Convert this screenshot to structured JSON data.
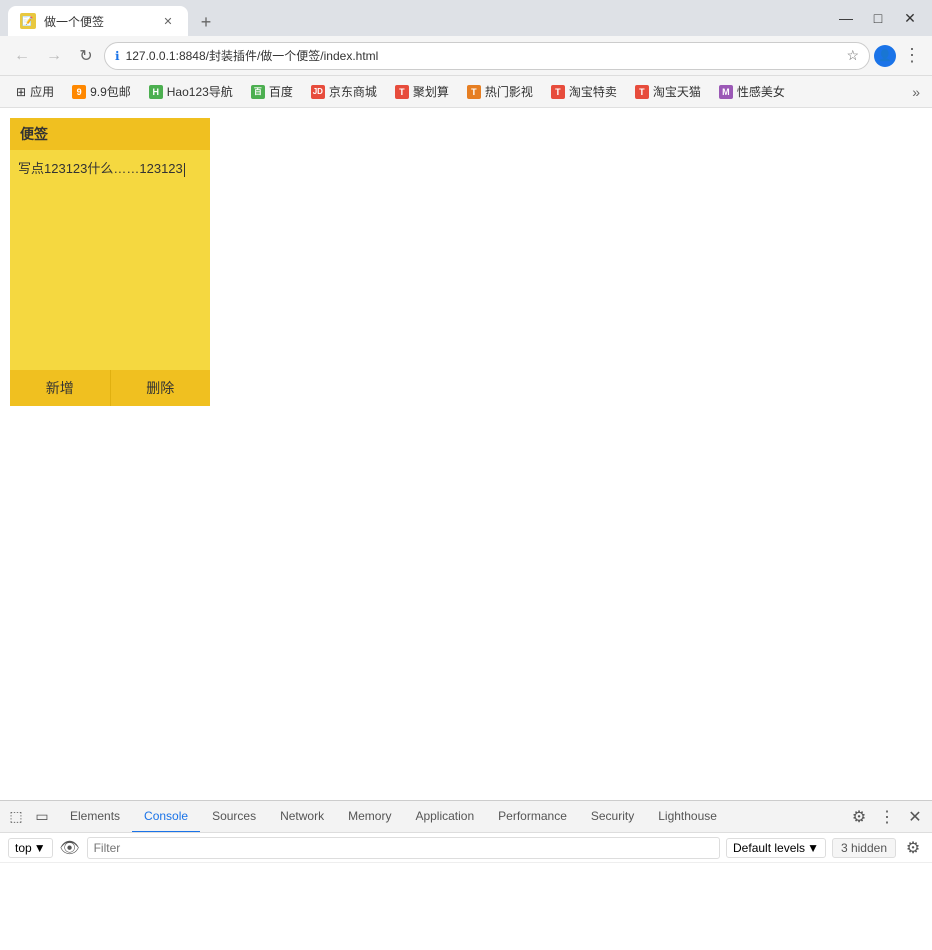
{
  "browser": {
    "tab_title": "做一个便签",
    "url": "127.0.0.1:8848/封装插件/做一个便签/index.html",
    "new_tab_label": "+",
    "window_controls": {
      "minimize": "—",
      "maximize": "□",
      "close": "✕"
    }
  },
  "bookmarks": [
    {
      "id": "apps",
      "label": "应用",
      "icon_color": "#555",
      "icon_char": "⊞"
    },
    {
      "id": "99baobao",
      "label": "9.9包邮",
      "icon_color": "#f80",
      "icon_char": "9"
    },
    {
      "id": "hao123",
      "label": "Hao123导航",
      "icon_color": "#4caf50",
      "icon_char": "H"
    },
    {
      "id": "baidu",
      "label": "百度",
      "icon_color": "#4caf50",
      "icon_char": "百"
    },
    {
      "id": "jd",
      "label": "京东商城",
      "icon_color": "#e74c3c",
      "icon_char": "JD"
    },
    {
      "id": "julisuan",
      "label": "聚划算",
      "icon_color": "#e74c3c",
      "icon_char": "T"
    },
    {
      "id": "remen",
      "label": "热门影视",
      "icon_color": "#e67e22",
      "icon_char": "T"
    },
    {
      "id": "taobaotemai",
      "label": "淘宝特卖",
      "icon_color": "#e74c3c",
      "icon_char": "T"
    },
    {
      "id": "taobao",
      "label": "淘宝天猫",
      "icon_color": "#e74c3c",
      "icon_char": "T"
    },
    {
      "id": "meitushennv",
      "label": "性感美女",
      "icon_color": "#9b59b6",
      "icon_char": "M"
    }
  ],
  "sticky_note": {
    "title": "便签",
    "content_text": "写点123123什么……123123",
    "add_button": "新增",
    "delete_button": "删除"
  },
  "devtools": {
    "tabs": [
      {
        "id": "elements",
        "label": "Elements",
        "active": false
      },
      {
        "id": "console",
        "label": "Console",
        "active": true
      },
      {
        "id": "sources",
        "label": "Sources",
        "active": false
      },
      {
        "id": "network",
        "label": "Network",
        "active": false
      },
      {
        "id": "memory",
        "label": "Memory",
        "active": false
      },
      {
        "id": "application",
        "label": "Application",
        "active": false
      },
      {
        "id": "performance",
        "label": "Performance",
        "active": false
      },
      {
        "id": "security",
        "label": "Security",
        "active": false
      },
      {
        "id": "lighthouse",
        "label": "Lighthouse",
        "active": false
      }
    ],
    "console_bar": {
      "context_selector": "top",
      "filter_placeholder": "Filter",
      "levels_label": "Default levels",
      "hidden_count": "3 hidden"
    }
  }
}
